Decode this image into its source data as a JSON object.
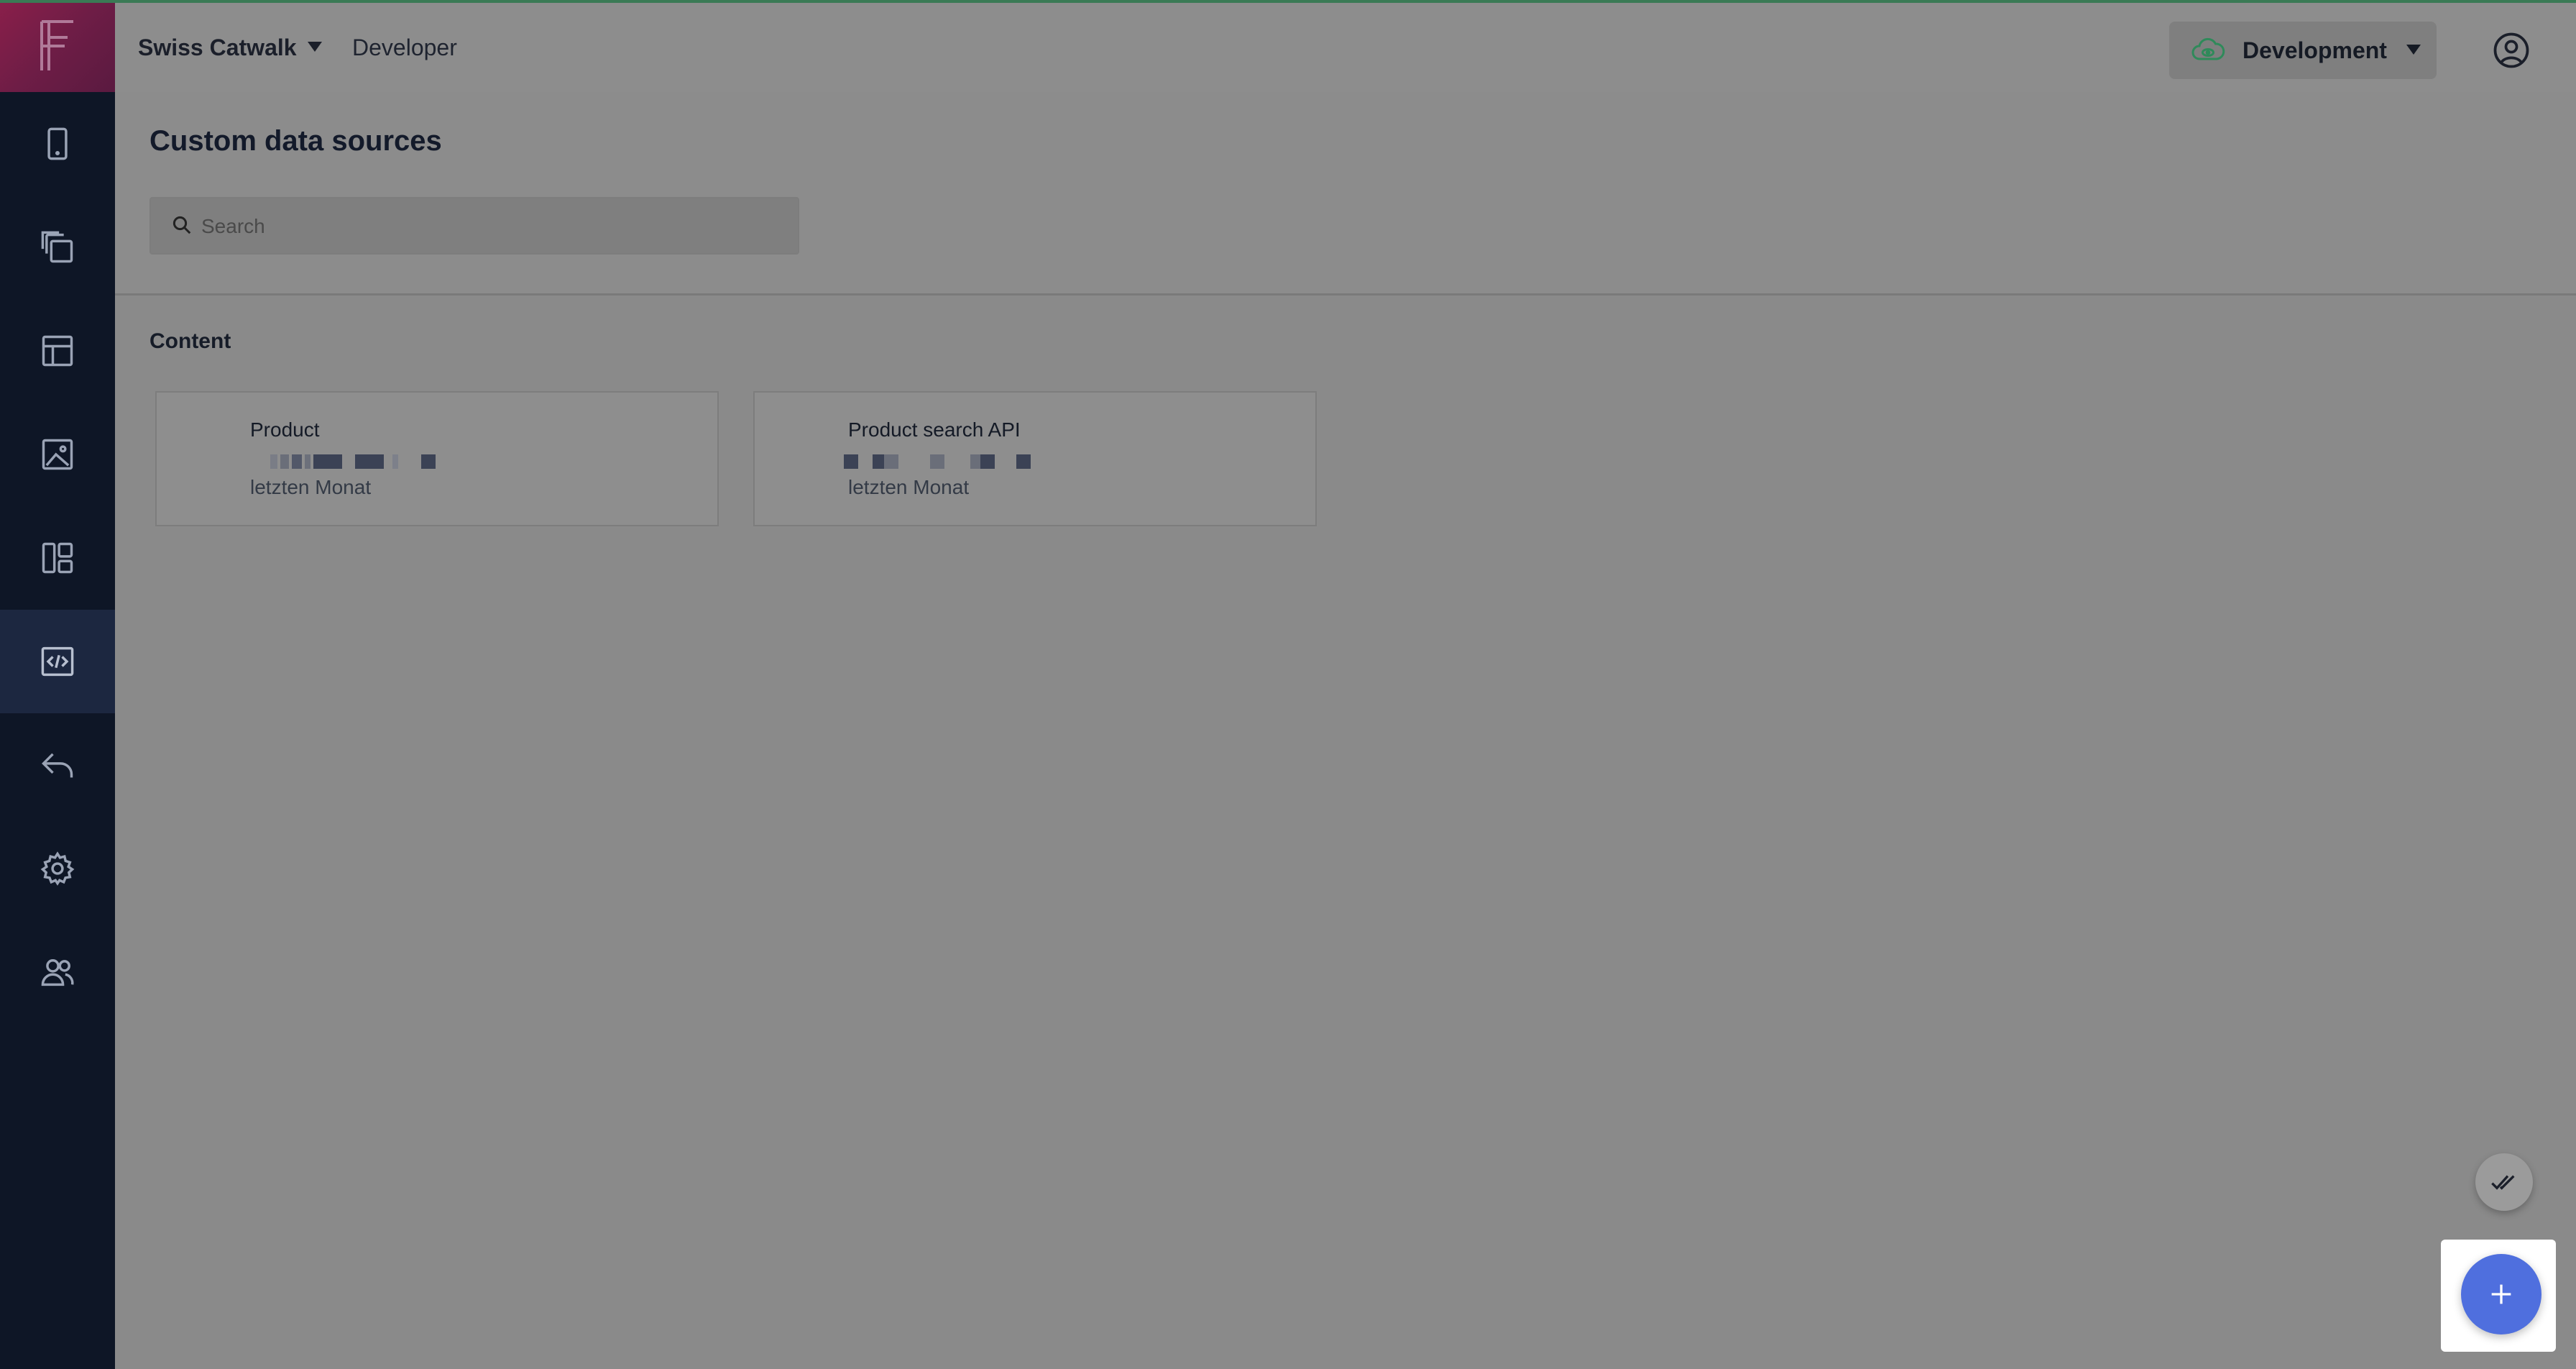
{
  "header": {
    "workspace": "Swiss Catwalk",
    "role": "Developer",
    "environment": "Development"
  },
  "page": {
    "title": "Custom data sources",
    "search_placeholder": "Search"
  },
  "section": {
    "label": "Content"
  },
  "cards": [
    {
      "name": "Product",
      "subtitle": "letzten Monat"
    },
    {
      "name": "Product search API",
      "subtitle": "letzten Monat"
    }
  ],
  "sidebar": {
    "items": [
      {
        "icon": "mobile-icon"
      },
      {
        "icon": "copy-icon"
      },
      {
        "icon": "layout-icon"
      },
      {
        "icon": "image-icon"
      },
      {
        "icon": "dashboard-icon"
      },
      {
        "icon": "code-icon",
        "active": true
      },
      {
        "icon": "reply-icon"
      },
      {
        "icon": "gear-icon"
      },
      {
        "icon": "users-icon"
      }
    ]
  },
  "colors": {
    "sidebar_bg": "#0e1626",
    "logo_gradient": "#8a1f4a",
    "accent_fab": "#4f6fde",
    "env_cloud": "#2f8a5a"
  }
}
